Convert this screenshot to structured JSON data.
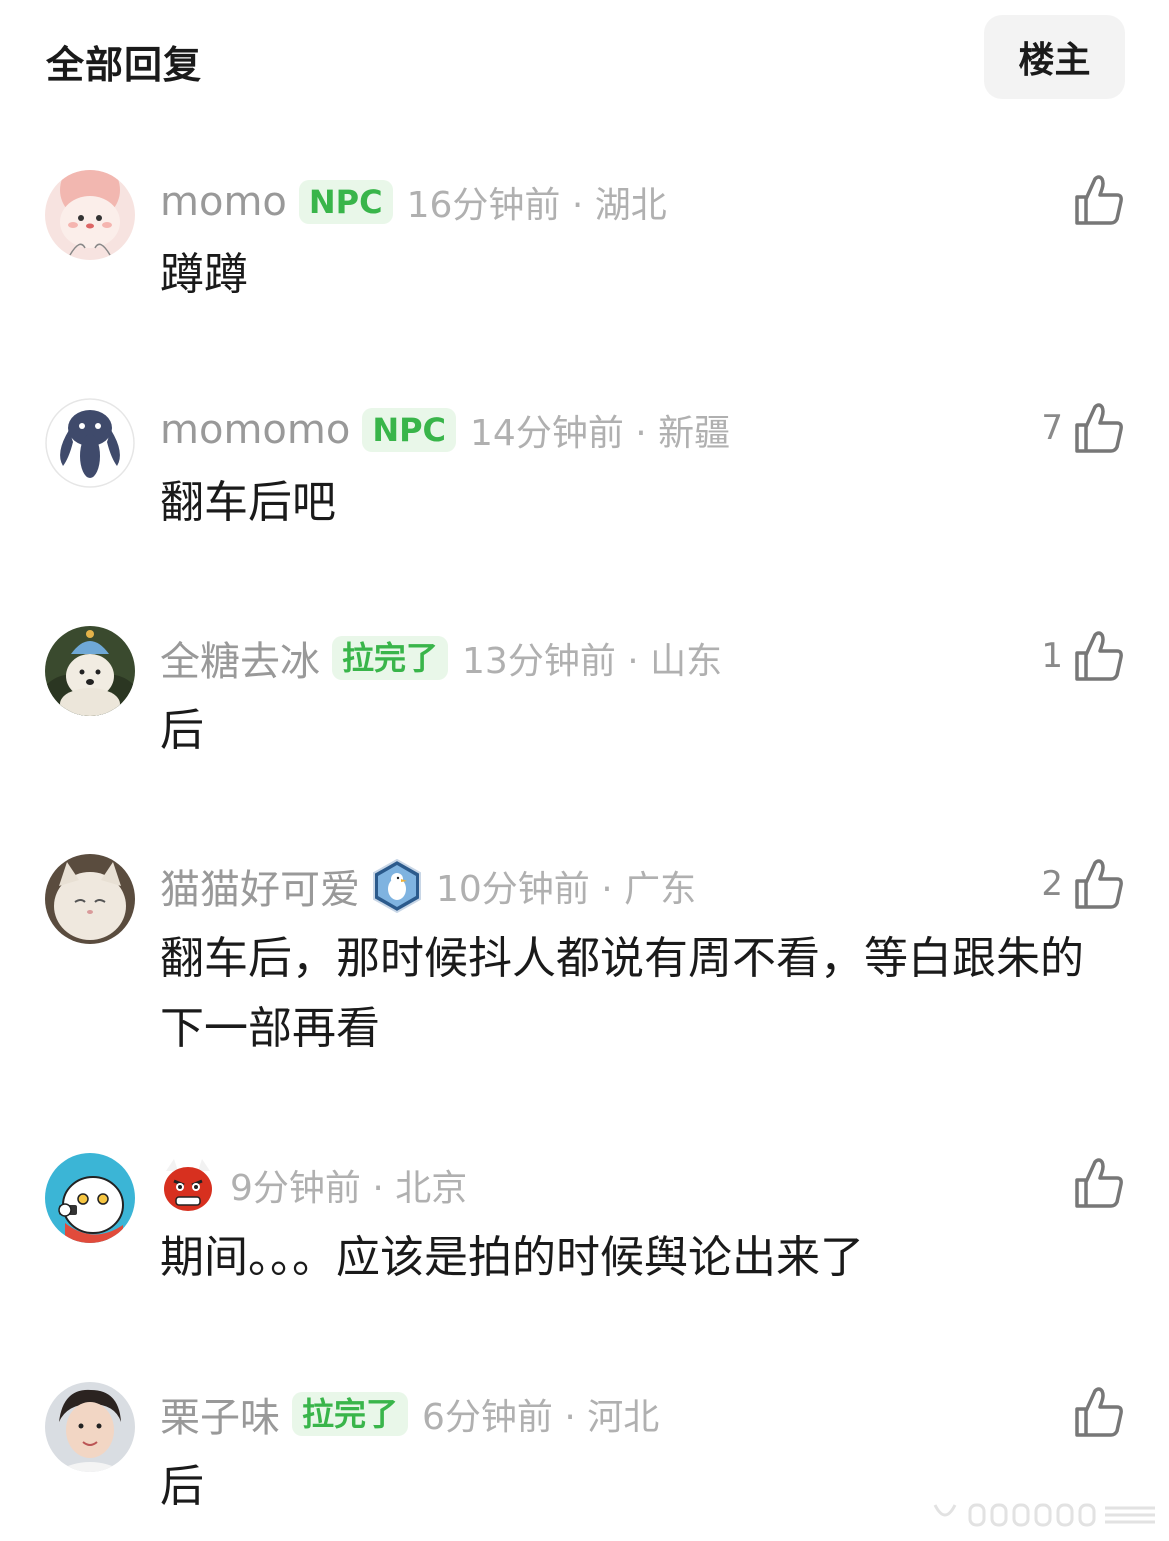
{
  "header": {
    "title": "全部回复",
    "op_filter_label": "楼主"
  },
  "comments": [
    {
      "username": "momo",
      "badge": "NPC",
      "time": "16分钟前",
      "location": "湖北",
      "time_location": "16分钟前 · 湖北",
      "text": "蹲蹲",
      "likes": "",
      "avatar_icon": "cartoon-girl-avatar"
    },
    {
      "username": "momomo",
      "badge": "NPC",
      "time": "14分钟前",
      "location": "新疆",
      "time_location": "14分钟前 · 新疆",
      "text": "翻车后吧",
      "likes": "7",
      "avatar_icon": "blue-creature-avatar"
    },
    {
      "username": "全糖去冰",
      "badge": "拉完了",
      "time": "13分钟前",
      "location": "山东",
      "time_location": "13分钟前 · 山东",
      "text": "后",
      "likes": "1",
      "avatar_icon": "plush-dog-avatar"
    },
    {
      "username": "猫猫好可爱",
      "badge_icon": "seagull-badge-icon",
      "time": "10分钟前",
      "location": "广东",
      "time_location": "10分钟前 · 广东",
      "text": "翻车后，那时候抖人都说有周不看，等白跟朱的下一部再看",
      "likes": "2",
      "avatar_icon": "white-cat-avatar"
    },
    {
      "username_emoji": "red-oni-mask-icon",
      "time": "9分钟前",
      "location": "北京",
      "time_location": "9分钟前 · 北京",
      "text": "期间。。。应该是拍的时候舆论出来了",
      "likes": "",
      "avatar_icon": "cartoon-cat-gun-avatar"
    },
    {
      "username": "栗子味",
      "badge": "拉完了",
      "time": "6分钟前",
      "location": "河北",
      "time_location": "6分钟前 · 河北",
      "text": "后",
      "likes": "",
      "avatar_icon": "person-photo-avatar"
    }
  ],
  "colors": {
    "badge_bg": "#e9f7e9",
    "badge_text": "#39b54a",
    "meta_text": "#b0b0b0",
    "username_text": "#999999",
    "body_text": "#1a1a1a",
    "button_bg": "#f3f3f3"
  }
}
